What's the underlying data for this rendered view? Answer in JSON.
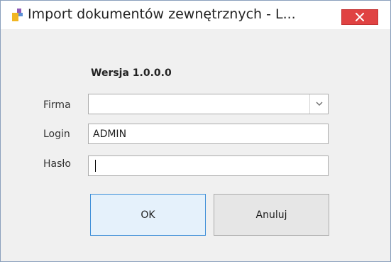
{
  "window": {
    "title": "Import dokumentów zewnętrznych - L...",
    "close_icon": "close-icon",
    "app_icon": "app-icon"
  },
  "form": {
    "version_label": "Wersja 1.0.0.0",
    "firma_label": "Firma",
    "firma_value": "",
    "login_label": "Login",
    "login_value": "ADMIN",
    "password_label": "Hasło",
    "password_value": ""
  },
  "buttons": {
    "ok_label": "OK",
    "cancel_label": "Anuluj"
  },
  "colors": {
    "close_button": "#e04343",
    "ok_border": "#3c8ed8",
    "window_background": "#f0f0f0"
  }
}
